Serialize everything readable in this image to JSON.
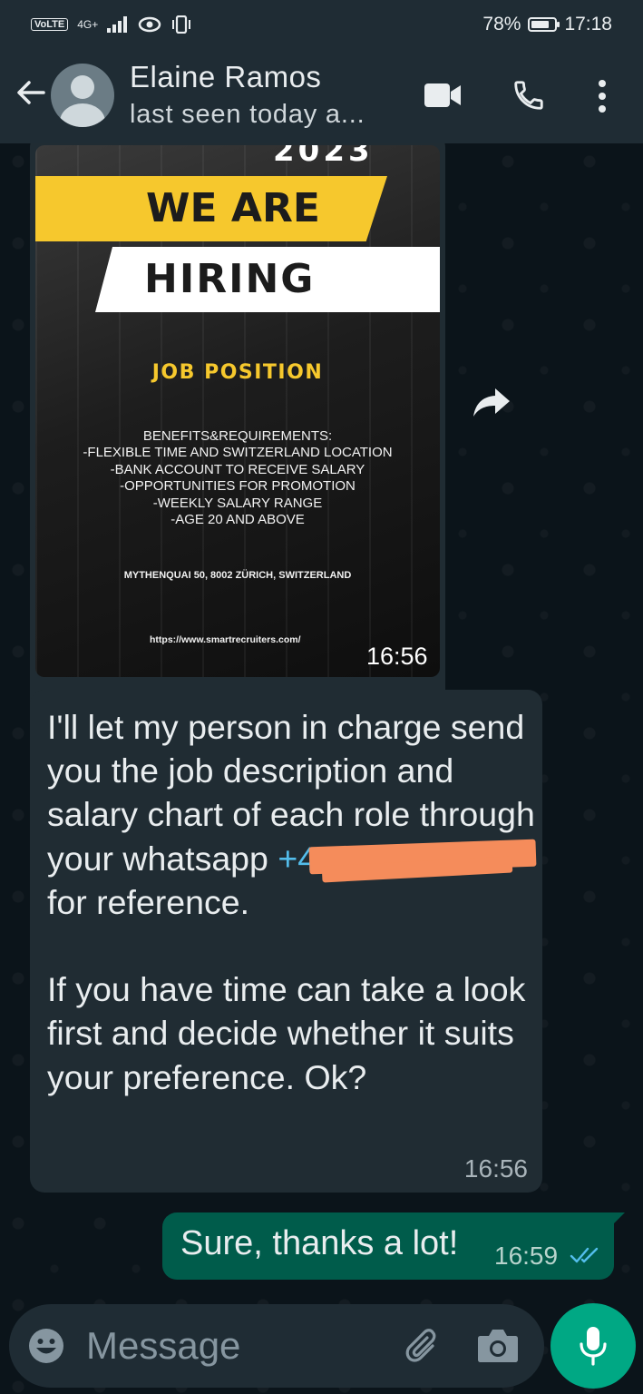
{
  "status_bar": {
    "volte": "VoLTE",
    "network": "4G+",
    "battery": "78%",
    "battery_level": 0.78,
    "time": "17:18"
  },
  "header": {
    "contact_name": "Elaine Ramos",
    "contact_status": "last seen today a...",
    "icons": [
      "back-arrow-icon",
      "avatar-placeholder-icon",
      "video-call-icon",
      "voice-call-icon",
      "more-vert-icon"
    ]
  },
  "messages": [
    {
      "type": "image",
      "direction": "incoming",
      "time": "16:56",
      "poster": {
        "year_partial": "2023",
        "line1": "WE ARE",
        "line2": "HIRING",
        "job_position": "JOB POSITION",
        "benefits": [
          "BENEFITS&REQUIREMENTS:",
          "-FLEXIBLE TIME AND SWITZERLAND LOCATION",
          "-BANK ACCOUNT TO RECEIVE SALARY",
          "-OPPORTUNITIES FOR PROMOTION",
          "-WEEKLY SALARY RANGE",
          "-AGE 20 AND ABOVE"
        ],
        "address": "MYTHENQUAI 50, 8002 ZÜRICH, SWITZERLAND",
        "url": "https://www.smartrecruiters.com/"
      }
    },
    {
      "type": "text",
      "direction": "incoming",
      "text_before": "I'll let my person in charge send you the job description and salary chart of each role through your whatsapp ",
      "phone_visible": "+4",
      "text_after": " for reference.",
      "text_para2": "If you have time can take a look first and decide whether it suits your preference. Ok?",
      "time": "16:56"
    },
    {
      "type": "text",
      "direction": "outgoing",
      "text": "Sure, thanks a lot!",
      "time": "16:59",
      "status": "read"
    }
  ],
  "composer": {
    "placeholder": "Message",
    "icons": [
      "emoji-icon",
      "attach-icon",
      "camera-icon",
      "mic-icon"
    ]
  },
  "colors": {
    "header_bg": "#1f2c34",
    "chat_bg": "#0b141a",
    "incoming_bubble": "#202c33",
    "outgoing_bubble": "#005c4b",
    "accent": "#00a884",
    "link": "#53bdeb",
    "read_ticks": "#53bdeb",
    "poster_yellow": "#f6c82d",
    "redaction": "#f58c5b"
  }
}
